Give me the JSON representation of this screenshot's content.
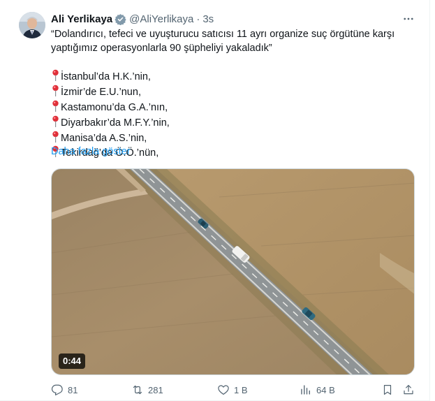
{
  "author": {
    "name": "Ali Yerlikaya",
    "handle": "@AliYerlikaya",
    "separator": "·",
    "time": "3s"
  },
  "tweet": {
    "lines": [
      "“Dolandırıcı, tefeci ve uyuşturucu satıcısı 11 ayrı organize suç örgütüne karşı",
      "yaptığımız operasyonlarla 90 şüpheliyi yakaladık”"
    ],
    "locations": [
      "İstanbul’da H.K.’nin,",
      "İzmir’de E.U.’nun,",
      "Kastamonu’da G.A.’nın,",
      "Diyarbakır’da M.F.Y.’nin,",
      "Manisa’da A.S.’nin,",
      "Tekirdağ’da Ö.Ö.’nün,"
    ],
    "show_more": "Daha fazla göster"
  },
  "media": {
    "duration": "0:44"
  },
  "actions": {
    "replies": "81",
    "reposts": "281",
    "likes": "1 B",
    "views": "64 B"
  },
  "icons": {
    "verified": "verified-badge-icon",
    "more": "more-horizontal-icon",
    "location": "round-pushpin-icon",
    "reply": "reply-icon",
    "repost": "repost-icon",
    "like": "heart-icon",
    "views": "views-chart-icon",
    "bookmark": "bookmark-icon",
    "share": "share-icon"
  },
  "colors": {
    "link": "#1d9bf0",
    "verified": "#829aab",
    "secondary_text": "#536471",
    "pin": "#e0303a"
  }
}
